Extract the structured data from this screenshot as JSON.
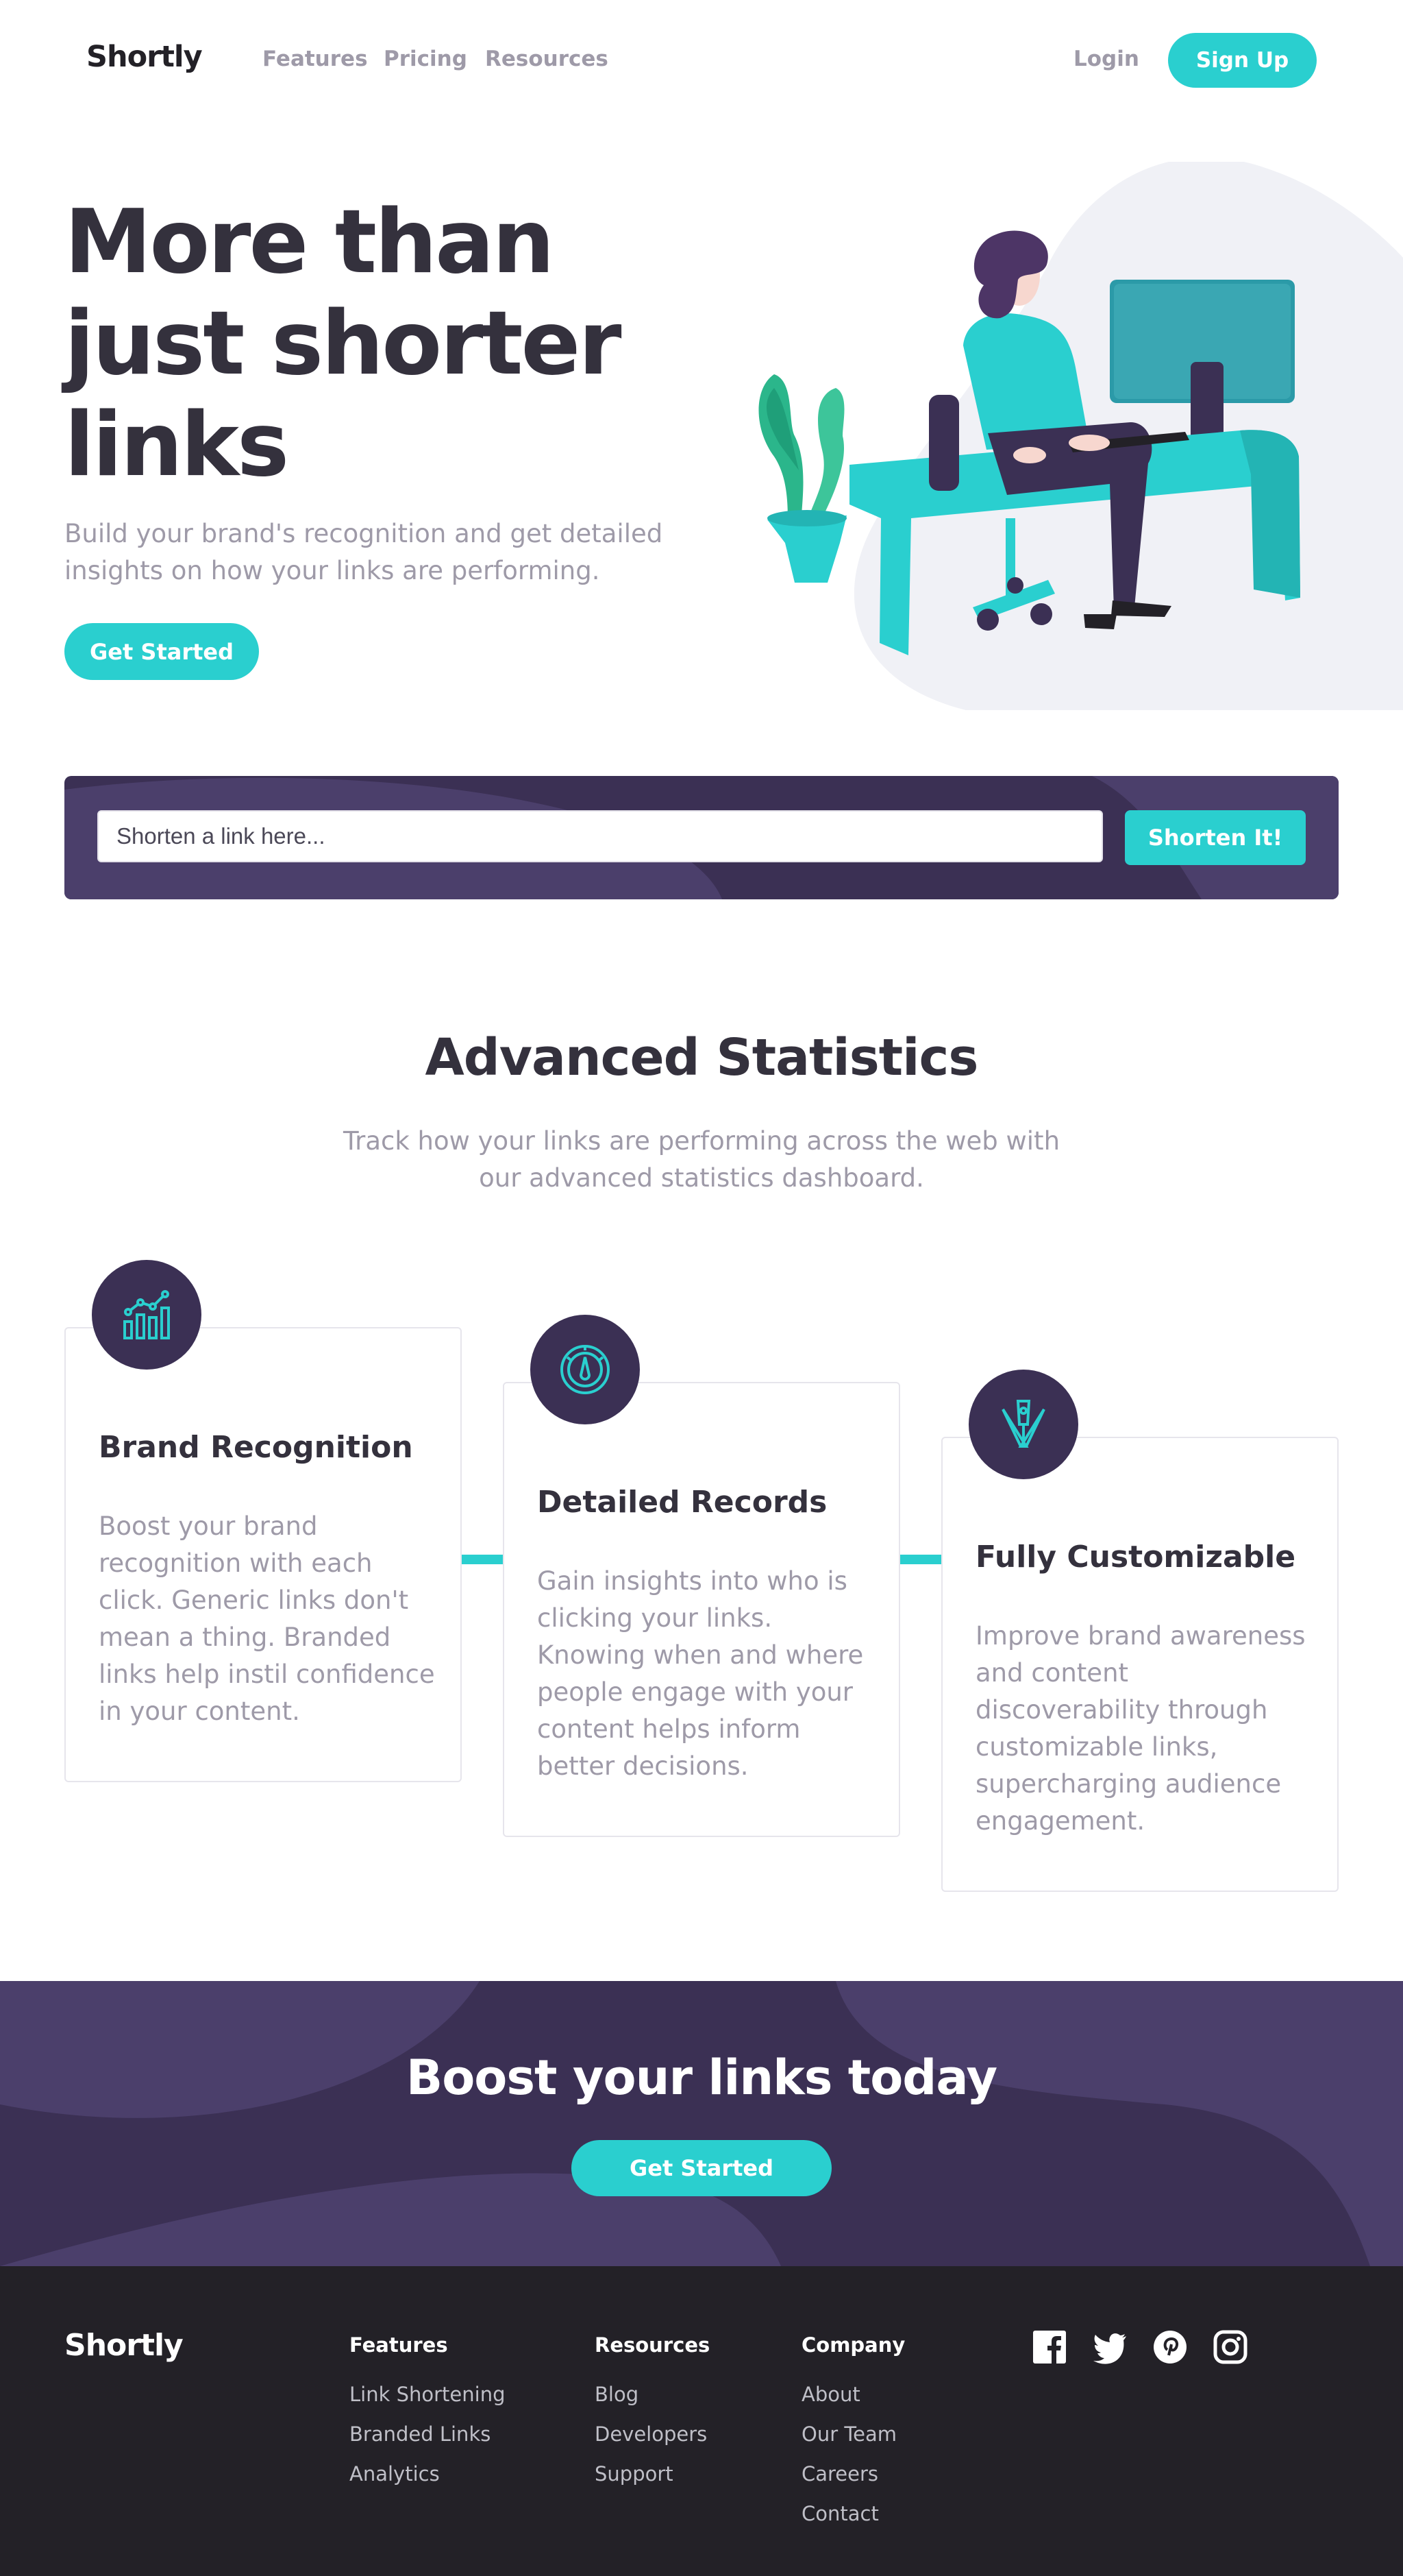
{
  "header": {
    "logo": "Shortly",
    "nav": [
      "Features",
      "Pricing",
      "Resources"
    ],
    "login": "Login",
    "signup": "Sign Up"
  },
  "hero": {
    "title_lines": [
      "More than",
      "just shorter",
      "links"
    ],
    "subtitle": "Build your brand's recognition and get detailed insights on how your links are performing.",
    "cta": "Get Started",
    "illustration": "person-working-at-desk-illustration"
  },
  "shorten": {
    "placeholder": "Shorten a link here...",
    "button": "Shorten It!"
  },
  "stats": {
    "title": "Advanced Statistics",
    "subtitle_lines": [
      "Track how your links are performing across the web with",
      "our advanced statistics dashboard."
    ],
    "cards": [
      {
        "icon": "bar-chart-icon",
        "title": "Brand Recognition",
        "text": "Boost your brand recognition with each click. Generic links don't mean a thing. Branded links help instil confidence in your content."
      },
      {
        "icon": "speedometer-icon",
        "title": "Detailed Records",
        "text": "Gain insights into who is clicking your links. Knowing when and where people engage with your content helps inform better decisions."
      },
      {
        "icon": "brushes-icon",
        "title": "Fully Customizable",
        "text": "Improve brand awareness and content discoverability through customizable links, supercharging audience engagement."
      }
    ]
  },
  "boost": {
    "title": "Boost your links today",
    "cta": "Get Started"
  },
  "footer": {
    "logo": "Shortly",
    "columns": [
      {
        "heading": "Features",
        "links": [
          "Link Shortening",
          "Branded Links",
          "Analytics"
        ]
      },
      {
        "heading": "Resources",
        "links": [
          "Blog",
          "Developers",
          "Support"
        ]
      },
      {
        "heading": "Company",
        "links": [
          "About",
          "Our Team",
          "Careers",
          "Contact"
        ]
      }
    ],
    "social": [
      "facebook-icon",
      "twitter-icon",
      "pinterest-icon",
      "instagram-icon"
    ]
  },
  "colors": {
    "cyan": "#2acfcf",
    "dark_violet": "#3b3054",
    "grayish_violet": "#9e9aa8",
    "very_dark_blue": "#34313d",
    "very_dark_violet": "#232127"
  }
}
